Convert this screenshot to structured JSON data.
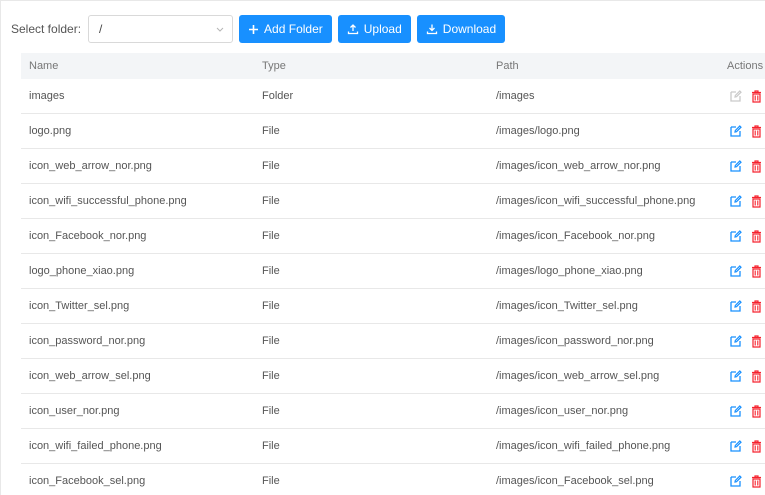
{
  "toolbar": {
    "folder_label": "Select folder:",
    "folder_value": "/",
    "add_folder_label": "Add Folder",
    "upload_label": "Upload",
    "download_label": "Download"
  },
  "table": {
    "headers": {
      "name": "Name",
      "type": "Type",
      "path": "Path",
      "actions": "Actions"
    },
    "rows": [
      {
        "name": "images",
        "type": "Folder",
        "path": "/images",
        "edit_enabled": false
      },
      {
        "name": "logo.png",
        "type": "File",
        "path": "/images/logo.png",
        "edit_enabled": true
      },
      {
        "name": "icon_web_arrow_nor.png",
        "type": "File",
        "path": "/images/icon_web_arrow_nor.png",
        "edit_enabled": true
      },
      {
        "name": "icon_wifi_successful_phone.png",
        "type": "File",
        "path": "/images/icon_wifi_successful_phone.png",
        "edit_enabled": true
      },
      {
        "name": "icon_Facebook_nor.png",
        "type": "File",
        "path": "/images/icon_Facebook_nor.png",
        "edit_enabled": true
      },
      {
        "name": "logo_phone_xiao.png",
        "type": "File",
        "path": "/images/logo_phone_xiao.png",
        "edit_enabled": true
      },
      {
        "name": "icon_Twitter_sel.png",
        "type": "File",
        "path": "/images/icon_Twitter_sel.png",
        "edit_enabled": true
      },
      {
        "name": "icon_password_nor.png",
        "type": "File",
        "path": "/images/icon_password_nor.png",
        "edit_enabled": true
      },
      {
        "name": "icon_web_arrow_sel.png",
        "type": "File",
        "path": "/images/icon_web_arrow_sel.png",
        "edit_enabled": true
      },
      {
        "name": "icon_user_nor.png",
        "type": "File",
        "path": "/images/icon_user_nor.png",
        "edit_enabled": true
      },
      {
        "name": "icon_wifi_failed_phone.png",
        "type": "File",
        "path": "/images/icon_wifi_failed_phone.png",
        "edit_enabled": true
      },
      {
        "name": "icon_Facebook_sel.png",
        "type": "File",
        "path": "/images/icon_Facebook_sel.png",
        "edit_enabled": true
      }
    ]
  },
  "icons": {
    "folder_select": "chevron-down-icon",
    "add_folder": "plus-icon",
    "upload": "upload-icon",
    "download": "download-icon",
    "edit": "edit-icon",
    "delete": "trash-icon"
  },
  "colors": {
    "primary": "#1890ff",
    "edit_enabled": "#1890ff",
    "edit_disabled": "#c9c9c9",
    "delete": "#f5222d",
    "header_bg": "#f3f5f7"
  }
}
